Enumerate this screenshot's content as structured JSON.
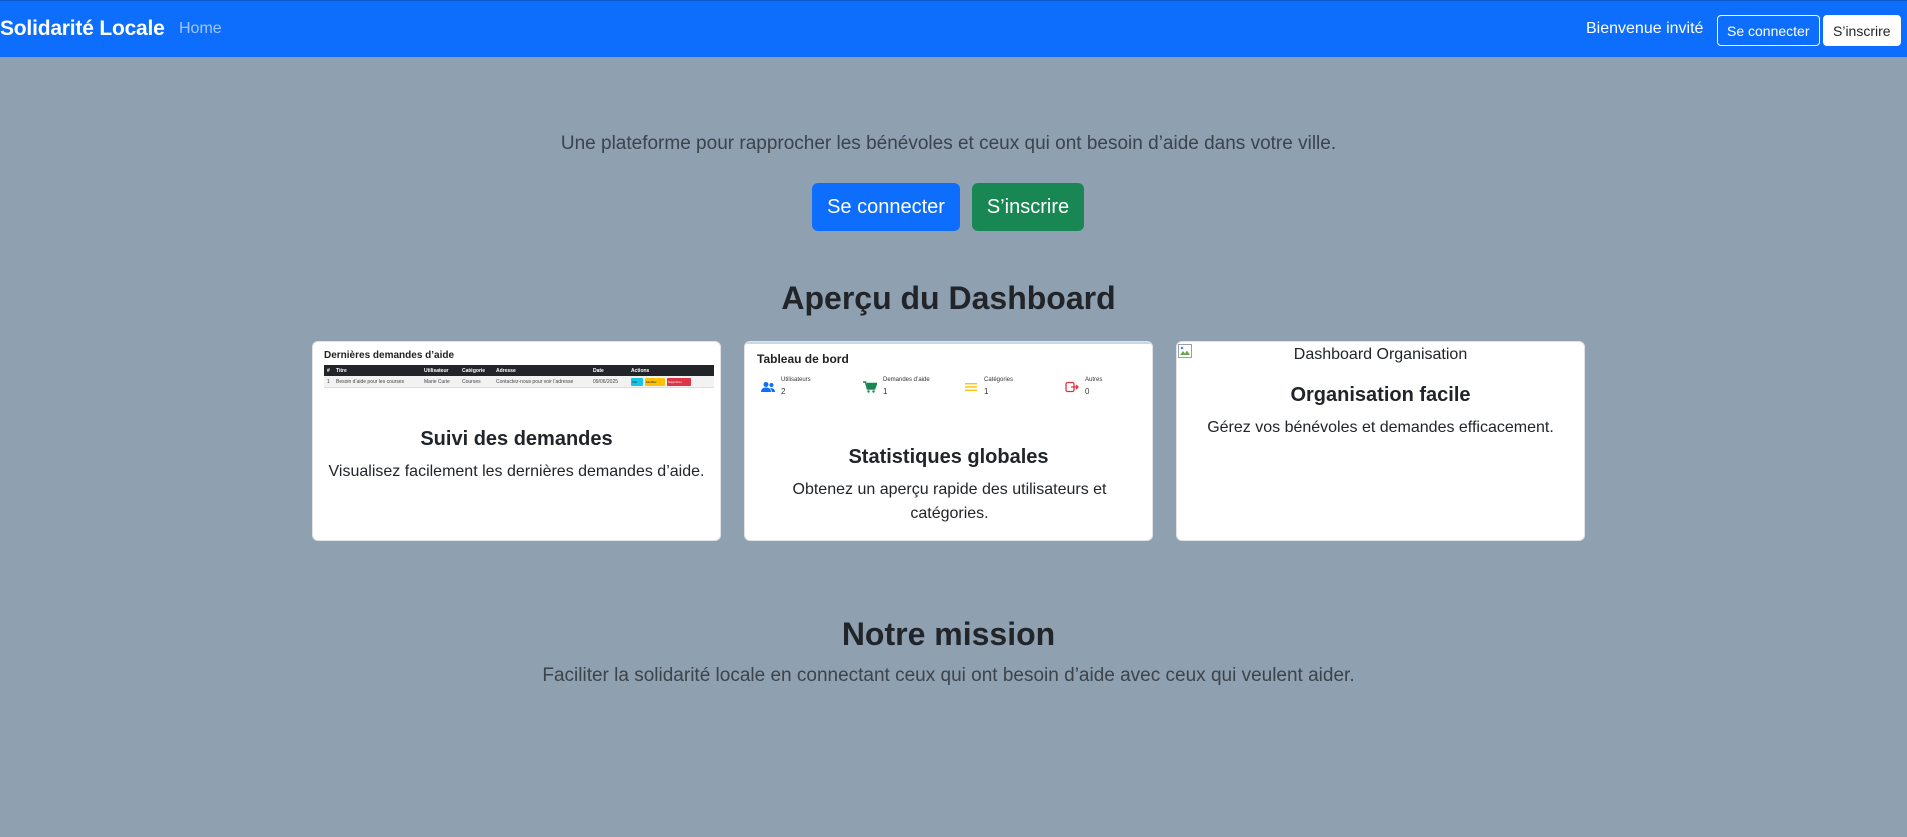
{
  "navbar": {
    "brand": "Solidarité Locale",
    "home": "Home",
    "welcome": "Bienvenue invité",
    "login": "Se connecter",
    "signup": "S’inscrire"
  },
  "hero": {
    "tagline": "Une plateforme pour rapprocher les bénévoles et ceux qui ont besoin d’aide dans votre ville.",
    "login_button": "Se connecter",
    "signup_button": "S’inscrire"
  },
  "dashboard": {
    "title": "Aperçu du Dashboard",
    "cards": [
      {
        "title": "Suivi des demandes",
        "text": "Visualisez facilement les dernières demandes d’aide.",
        "preview": {
          "title": "Dernières demandes d’aide",
          "columns": [
            "#",
            "Titre",
            "Utilisateur",
            "Catégorie",
            "Adresse",
            "Date",
            "Actions"
          ],
          "row": [
            "1",
            "Besoin d’aide pour les courses",
            "Marie Curie",
            "Courses",
            "Contactez-nous pour voir l’adresse",
            "09/06/2025"
          ],
          "actions": [
            "Voir",
            "Modifier",
            "Supprimer"
          ]
        }
      },
      {
        "title": "Statistiques globales",
        "text": "Obtenez un aperçu rapide des utilisateurs et catégories.",
        "preview": {
          "title": "Tableau de bord",
          "stats": [
            {
              "label": "Utilisateurs",
              "value": "2",
              "icon": "users-icon",
              "color": "#0d6efd"
            },
            {
              "label": "Demandes d’aide",
              "value": "1",
              "icon": "cart-icon",
              "color": "#198754"
            },
            {
              "label": "Catégories",
              "value": "1",
              "icon": "list-icon",
              "color": "#ffc107"
            },
            {
              "label": "Autres",
              "value": "0",
              "icon": "exit-icon",
              "color": "#dc3545"
            }
          ]
        }
      },
      {
        "image_alt": "Dashboard Organisation",
        "title": "Organisation facile",
        "text": "Gérez vos bénévoles et demandes efficacement."
      }
    ]
  },
  "mission": {
    "title": "Notre mission",
    "text": "Faciliter la solidarité locale en connectant ceux qui ont besoin d’aide avec ceux qui veulent aider."
  },
  "colors": {
    "primary": "#0d6efd",
    "success": "#198754",
    "background": "#8fa0b0"
  }
}
